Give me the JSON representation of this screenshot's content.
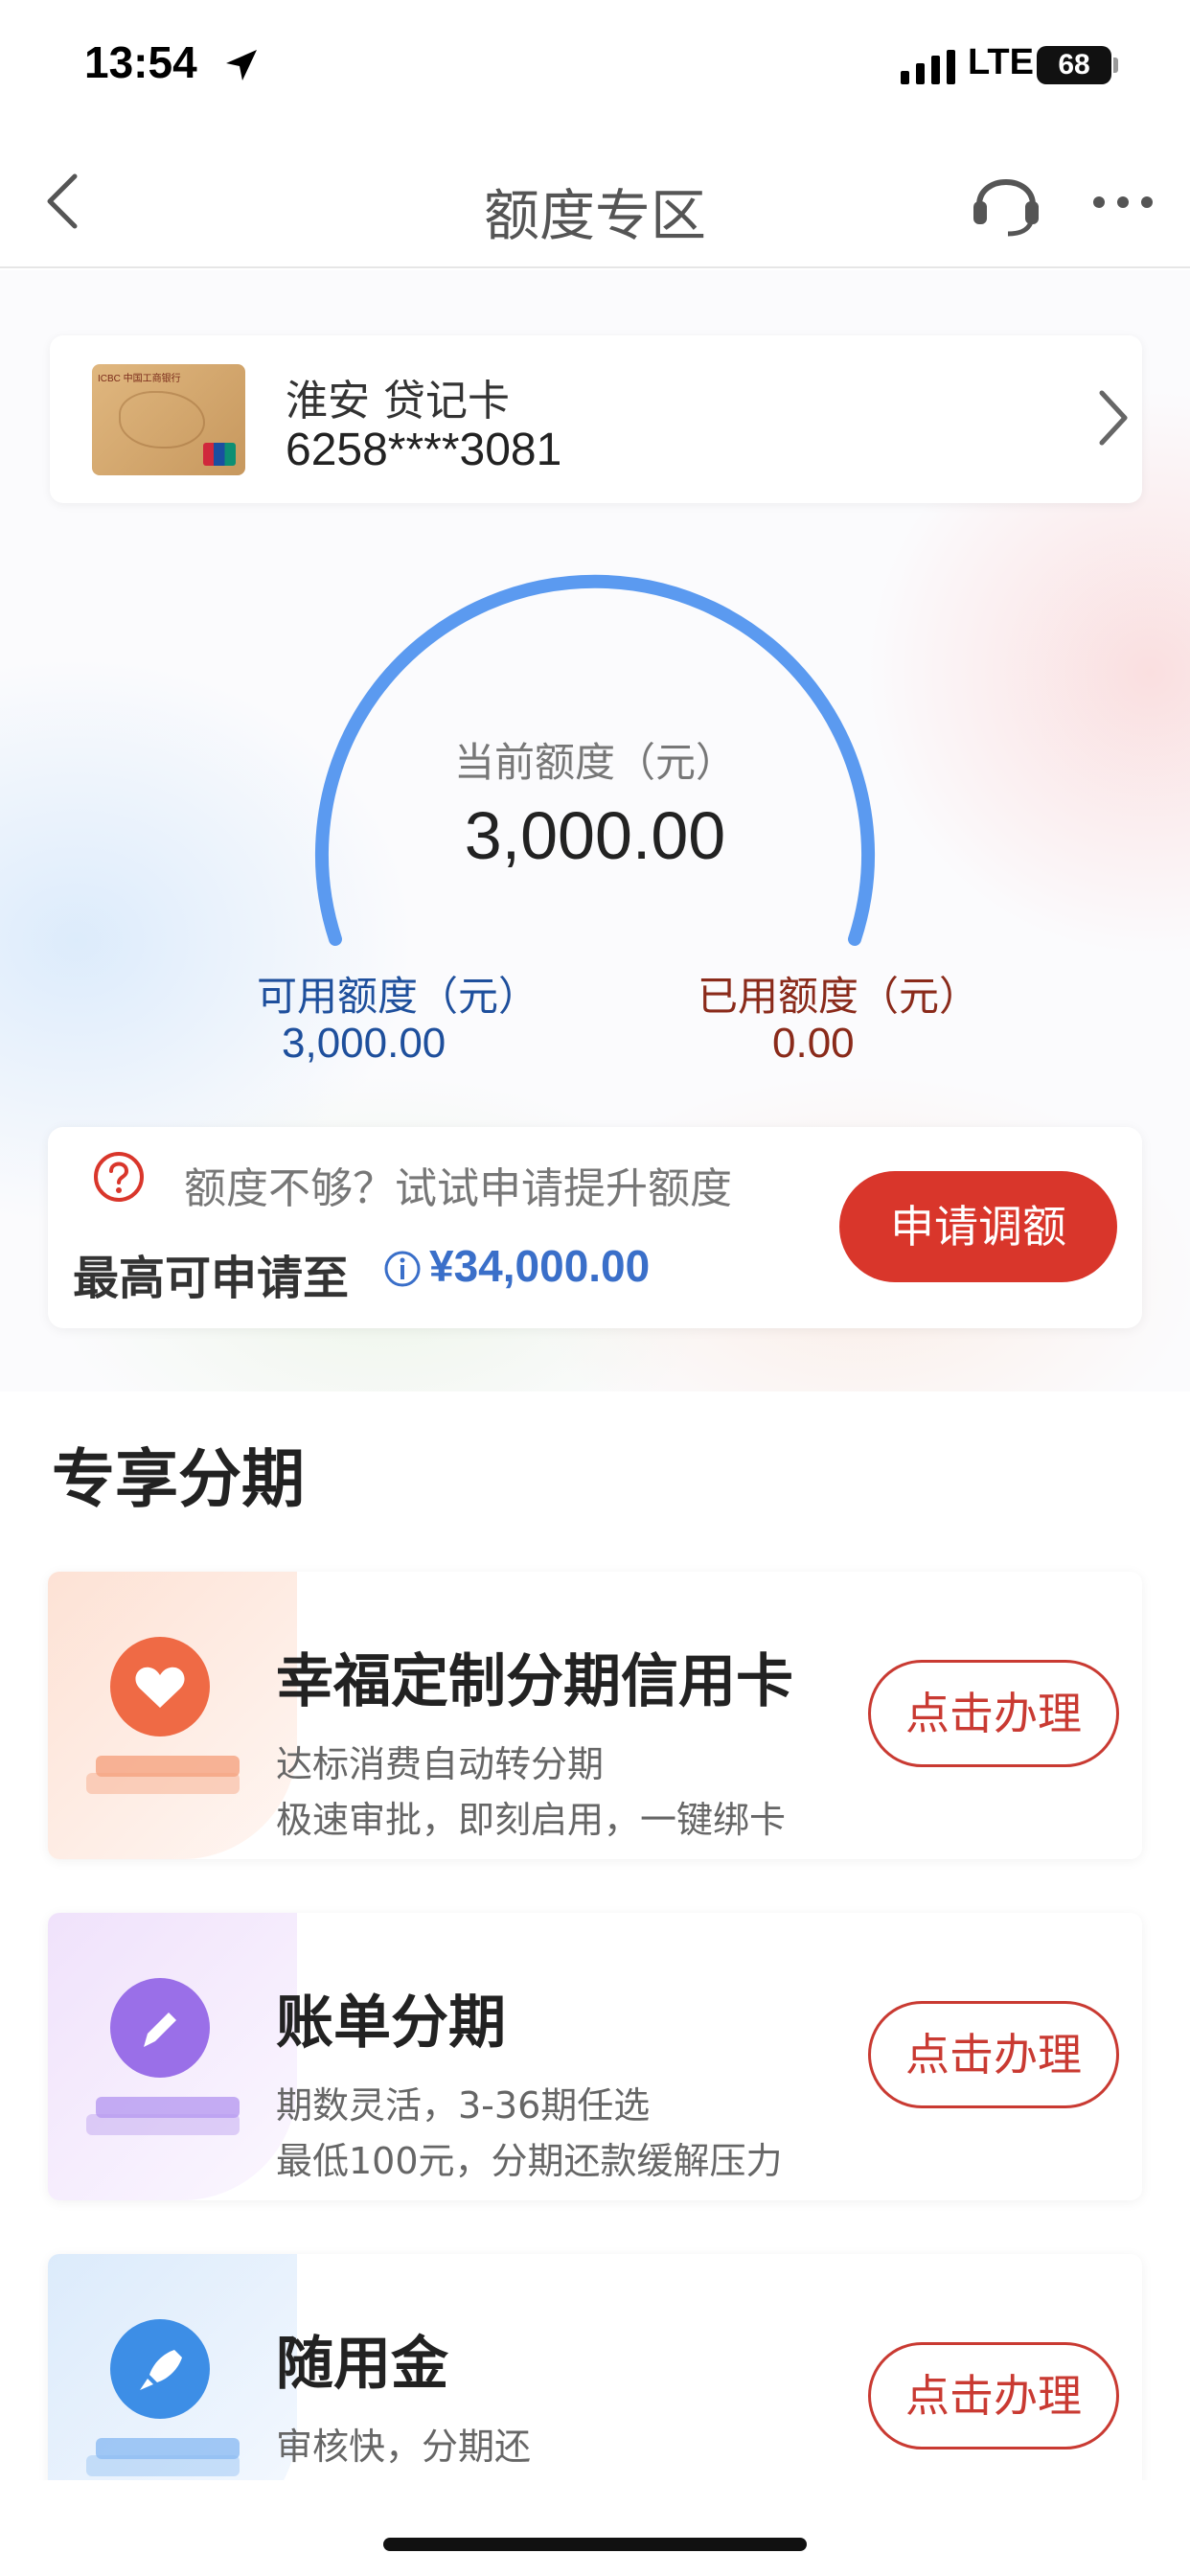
{
  "status_bar": {
    "time": "13:54",
    "network": "LTE",
    "battery": "68"
  },
  "nav": {
    "title": "额度专区"
  },
  "card": {
    "name": "淮安 贷记卡",
    "number": "6258****3081"
  },
  "gauge": {
    "label": "当前额度（元）",
    "value": "3,000.00",
    "usage_fraction": 0
  },
  "available": {
    "label": "可用额度（元）",
    "value": "3,000.00"
  },
  "used": {
    "label": "已用额度（元）",
    "value": "0.00"
  },
  "raise": {
    "tip": "额度不够？试试申请提升额度",
    "max_label": "最高可申请至",
    "max_value": "¥34,000.00",
    "button": "申请调额"
  },
  "section": {
    "title": "专享分期"
  },
  "promos": [
    {
      "title": "幸福定制分期信用卡",
      "line1": "达标消费自动转分期",
      "line2": "极速审批，即刻启用，一键绑卡",
      "button": "点击办理",
      "icon": "heart-icon"
    },
    {
      "title": "账单分期",
      "line1": "期数灵活，3-36期任选",
      "line2": "最低100元，分期还款缓解压力",
      "button": "点击办理",
      "icon": "pencil-icon"
    },
    {
      "title": "随用金",
      "line1": "审核快，分期还",
      "line2": "",
      "button": "点击办理",
      "icon": "rocket-icon"
    }
  ],
  "colors": {
    "accent_red": "#d9362b",
    "gauge_blue": "#5b9af0",
    "available_blue": "#1e4f9c",
    "used_brown": "#8a2a1a"
  }
}
